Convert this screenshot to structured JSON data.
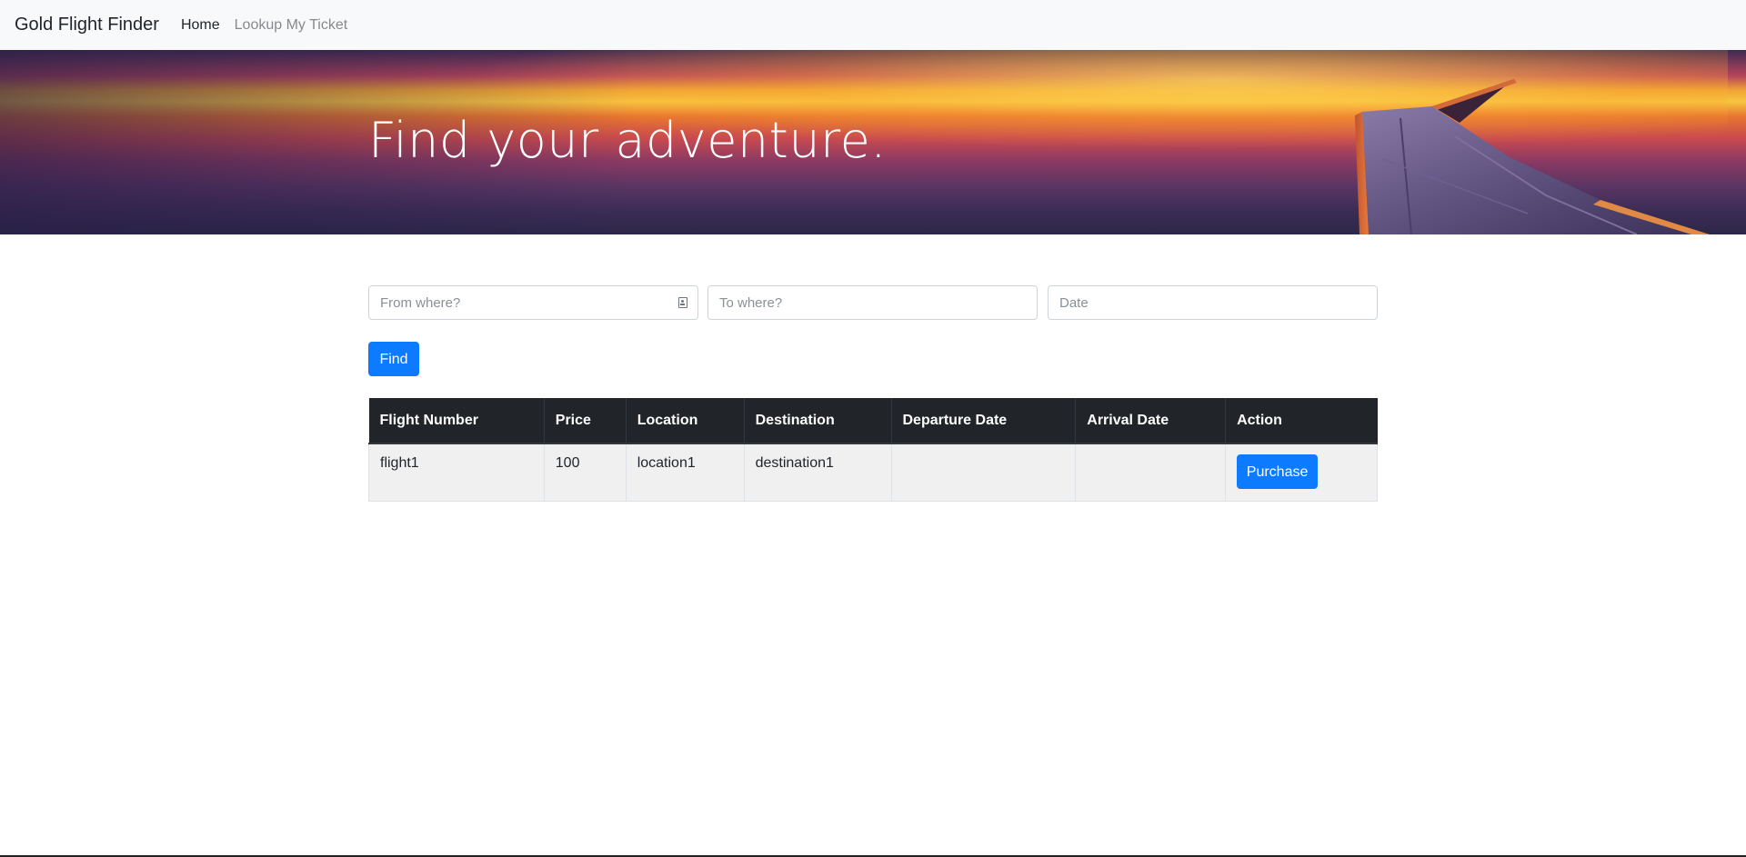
{
  "navbar": {
    "brand": "Gold Flight Finder",
    "links": [
      {
        "label": "Home",
        "active": true
      },
      {
        "label": "Lookup My Ticket",
        "active": false
      }
    ]
  },
  "hero": {
    "title": "Find your adventure."
  },
  "search": {
    "from_placeholder": "From where?",
    "from_value": "",
    "to_placeholder": "To where?",
    "to_value": "",
    "date_placeholder": "Date",
    "date_value": "",
    "find_label": "Find"
  },
  "table": {
    "headers": [
      "Flight Number",
      "Price",
      "Location",
      "Destination",
      "Departure Date",
      "Arrival Date",
      "Action"
    ],
    "rows": [
      {
        "flight_number": "flight1",
        "price": "100",
        "location": "location1",
        "destination": "destination1",
        "departure_date": "",
        "arrival_date": "",
        "action_label": "Purchase"
      }
    ]
  },
  "colors": {
    "primary": "#0d7bff",
    "navbar_bg": "#f8f9fa",
    "table_header_bg": "#212529",
    "row_bg": "#f0f0f0"
  },
  "icons": {
    "from_field_icon": "contact-card-icon"
  }
}
